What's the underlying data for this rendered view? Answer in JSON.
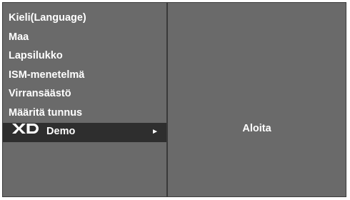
{
  "menu": {
    "items": [
      {
        "label": "Kieli(Language)"
      },
      {
        "label": "Maa"
      },
      {
        "label": "Lapsilukko"
      },
      {
        "label": "ISM-menetelmä"
      },
      {
        "label": "Virransäästö"
      },
      {
        "label": "Määritä tunnus"
      },
      {
        "label": "Demo",
        "selected": true,
        "logo": "XD",
        "arrow": "►"
      }
    ]
  },
  "submenu": {
    "action_label": "Aloita"
  },
  "colors": {
    "panel": "#6a6a6a",
    "selected": "#2e2e2e",
    "text": "#ffffff"
  }
}
